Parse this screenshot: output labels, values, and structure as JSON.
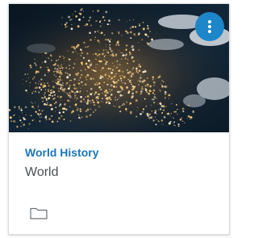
{
  "card": {
    "title": "World History",
    "subtitle": "World",
    "image": "earth-night-lights-image",
    "menu_icon": "more-vertical-icon",
    "folder_icon": "folder-icon"
  },
  "colors": {
    "accent": "#1d86c8",
    "title": "#1a78b8",
    "subtitle": "#4b4f54"
  }
}
